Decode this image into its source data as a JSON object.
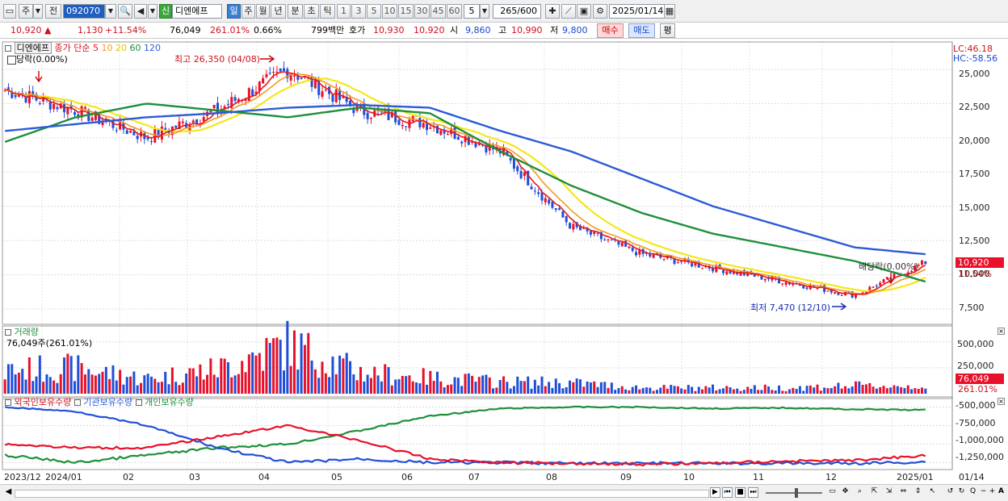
{
  "toolbar": {
    "btn_ju": "주",
    "btn_jeon": "전",
    "code": "092070",
    "btn_sin": "신",
    "stock_name": "디엔에프",
    "periods": [
      "일",
      "주",
      "월",
      "년",
      "분",
      "초",
      "틱"
    ],
    "active_period": "일",
    "numbers": [
      "1",
      "3",
      "5",
      "10",
      "15",
      "30",
      "45",
      "60"
    ],
    "count": "5",
    "range_text": "265",
    "range_total": "/600",
    "date": "2025/01/14"
  },
  "infobar": {
    "price": "10,920",
    "change": "1,130",
    "change_pct": "+11.54%",
    "volume": "76,049",
    "volume_pct": "261.01%",
    "turnover_pct": "0.66%",
    "amount": "799백만",
    "quote_label": "호가",
    "ask": "10,930",
    "bid": "10,920",
    "open_label": "시",
    "open": "9,860",
    "high_label": "고",
    "high": "10,990",
    "low_label": "저",
    "low": "9,800",
    "buy_label": "매수",
    "sell_label": "매도",
    "avg_label": "평"
  },
  "price_pane": {
    "title": "디엔에프",
    "legend": {
      "prefix": "종가 단순",
      "ma5": "5",
      "ma10": "10",
      "ma20": "20",
      "ma60": "60",
      "ma120": "120"
    },
    "badge": "당락(0.00%)",
    "high_annotation": "최고 26,350 (04/08)",
    "low_annotation": "최저 7,470 (12/10)",
    "div_annotation": "배당락(0.00%)",
    "lc": "LC:46.18",
    "hc": "HC:-58.56",
    "price_tag": "10,920",
    "pct_tag": "11.54%",
    "y_ticks": [
      "25,000",
      "22,500",
      "20,000",
      "17,500",
      "15,000",
      "12,500",
      "10,000",
      "7,500"
    ]
  },
  "volume_pane": {
    "title": "거래량",
    "value": "76,049주(261.01%)",
    "y_ticks": [
      "500,000",
      "250,000"
    ],
    "tag_value": "76,049",
    "tag_pct": "261.01%"
  },
  "holding_pane": {
    "legend": [
      "외국인보유수량",
      "기관보유수량",
      "개인보유수량"
    ],
    "y_ticks": [
      "-500,000",
      "-750,000",
      "-1,000,000",
      "-1,250,000"
    ]
  },
  "x_axis": [
    "2023/12",
    "2024/01",
    "02",
    "03",
    "04",
    "05",
    "06",
    "07",
    "08",
    "09",
    "10",
    "11",
    "12",
    "2025/01",
    "01/14"
  ],
  "colors": {
    "up": "#e8102a",
    "down": "#1f4fd8",
    "ma5": "#e31a1c",
    "ma10": "#f39a1e",
    "ma20": "#f5e61a",
    "ma60": "#1e8f3a",
    "ma120": "#2c5bd8"
  },
  "chart_data": {
    "type": "candlestick",
    "x": [
      "2023-12",
      "2024-01",
      "2024-02",
      "2024-03",
      "2024-04",
      "2024-05",
      "2024-06",
      "2024-07",
      "2024-08",
      "2024-09",
      "2024-10",
      "2024-11",
      "2024-12",
      "2025-01"
    ],
    "close": [
      23500,
      22000,
      20000,
      22000,
      25000,
      22000,
      21000,
      19000,
      13500,
      11500,
      10500,
      9500,
      8500,
      10920
    ],
    "ma120": [
      20500,
      21000,
      21500,
      21800,
      22200,
      22400,
      22200,
      20500,
      19000,
      17000,
      15000,
      13500,
      12000,
      11500
    ],
    "ma60": [
      19700,
      21500,
      22500,
      22000,
      21500,
      22200,
      21800,
      19000,
      16500,
      14500,
      13000,
      12000,
      11000,
      9500
    ],
    "ylim": [
      6500,
      27000
    ],
    "volume": [
      240000,
      260000,
      150000,
      250000,
      500000,
      220000,
      160000,
      120000,
      110000,
      60000,
      60000,
      60000,
      80000,
      76049
    ],
    "foreign_holding": [
      -1000000,
      -1050000,
      -1050000,
      -900000,
      -750000,
      -950000,
      -1200000,
      -1250000,
      -1260000,
      -1270000,
      -1260000,
      -1230000,
      -1220000,
      -1150000
    ],
    "institution_holding": [
      -500000,
      -560000,
      -750000,
      -1050000,
      -1250000,
      -1200000,
      -1250000,
      -1250000,
      -1260000,
      -1260000,
      -1260000,
      -1260000,
      -1260000,
      -1240000
    ],
    "individual_holding": [
      -1150000,
      -1250000,
      -1150000,
      -1050000,
      -1000000,
      -820000,
      -620000,
      -520000,
      -500000,
      -500000,
      -520000,
      -510000,
      -530000,
      -540000
    ]
  }
}
